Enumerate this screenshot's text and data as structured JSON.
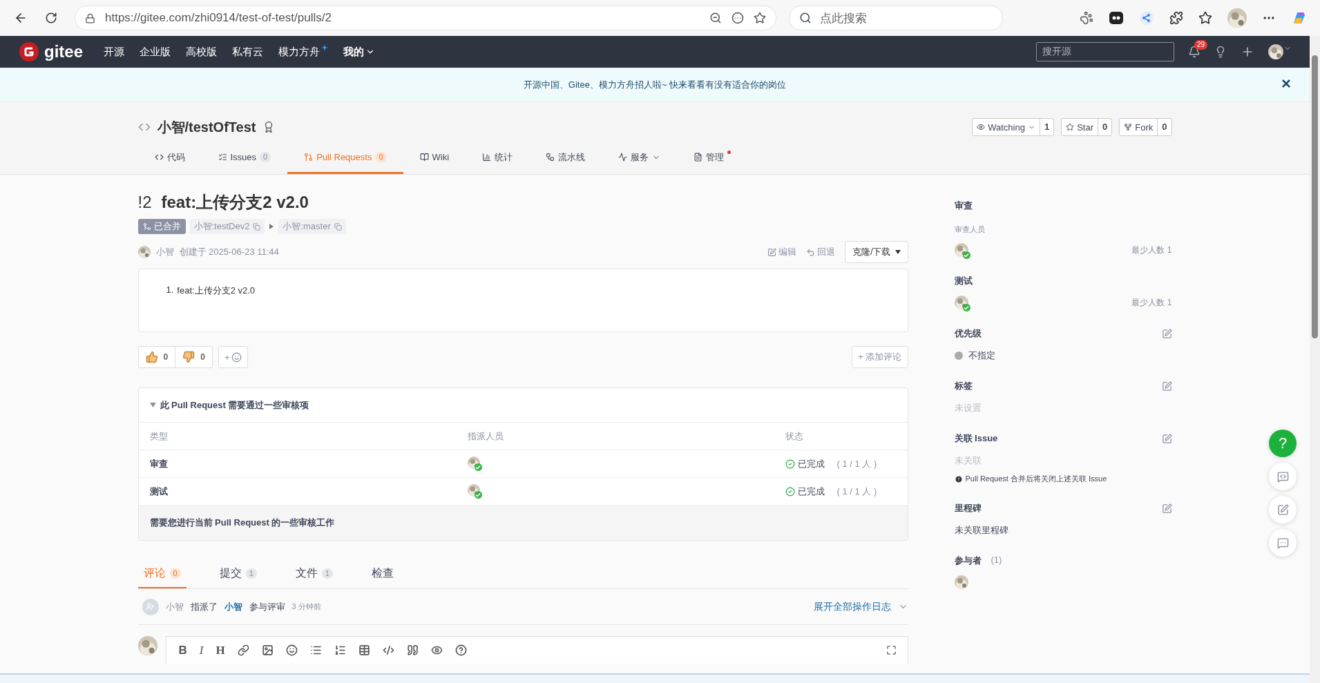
{
  "browser": {
    "url": "https://gitee.com/zhi0914/test-of-test/pulls/2",
    "search_placeholder": "点此搜索"
  },
  "nav": {
    "logo_text": "gitee",
    "items": [
      {
        "label": "开源",
        "kind": "link"
      },
      {
        "label": "企业版",
        "kind": "link"
      },
      {
        "label": "高校版",
        "kind": "link"
      },
      {
        "label": "私有云",
        "kind": "link"
      },
      {
        "label": "模力方舟",
        "kind": "sparkle"
      },
      {
        "label": "我的",
        "kind": "menu"
      }
    ],
    "search_placeholder": "搜开源",
    "notification_count": "29"
  },
  "banner": {
    "text": "开源中国、Gitee、模力方舟招人啦~ 快来看看有没有适合你的岗位"
  },
  "repo": {
    "name": "小智/testOfTest",
    "actions": [
      {
        "label": "Watching",
        "count": "1",
        "kind": "watch"
      },
      {
        "label": "Star",
        "count": "0",
        "kind": "star"
      },
      {
        "label": "Fork",
        "count": "0",
        "kind": "fork"
      }
    ],
    "tabs": [
      {
        "label": "代码",
        "kind": "code",
        "selected": false,
        "dropdown": false,
        "dot": false
      },
      {
        "label": "Issues",
        "count": "0",
        "kind": "issues",
        "selected": false,
        "dropdown": false,
        "dot": false
      },
      {
        "label": "Pull Requests",
        "count": "0",
        "kind": "pulls",
        "selected": true,
        "dropdown": false,
        "dot": false
      },
      {
        "label": "Wiki",
        "kind": "wiki",
        "selected": false,
        "dropdown": false,
        "dot": false
      },
      {
        "label": "统计",
        "kind": "stats",
        "selected": false,
        "dropdown": false,
        "dot": false
      },
      {
        "label": "流水线",
        "kind": "pipeline",
        "selected": false,
        "dropdown": false,
        "dot": false
      },
      {
        "label": "服务",
        "kind": "services",
        "selected": false,
        "dropdown": true,
        "dot": false
      },
      {
        "label": "管理",
        "kind": "manage",
        "selected": false,
        "dropdown": false,
        "dot": true
      }
    ]
  },
  "pr": {
    "number": "!2",
    "title": "feat:上传分支2 v2.0",
    "status": "已合并",
    "source_branch": "小智:testDev2",
    "target_branch": "小智:master",
    "author": "小智",
    "created": "创建于 2025-06-23 11:44",
    "actions": [
      {
        "label": "编辑",
        "kind": "edit"
      },
      {
        "label": "回退",
        "kind": "revert"
      }
    ],
    "clone_button": "克隆/下载",
    "description": [
      {
        "number": "1.",
        "text": "feat:上传分支2 v2.0"
      }
    ],
    "reactions": [
      {
        "kind": "up",
        "count": "0"
      },
      {
        "kind": "down",
        "count": "0"
      }
    ],
    "add_reaction": "+",
    "add_comment": "+ 添加评论"
  },
  "review": {
    "title": "此 Pull Request 需要通过一些审核项",
    "expanded": true,
    "columns": [
      "类型",
      "指派人员",
      "状态"
    ],
    "rows": [
      {
        "type": "审查",
        "status": "已完成",
        "progress": "( 1 / 1 人 )"
      },
      {
        "type": "测试",
        "status": "已完成",
        "progress": "( 1 / 1 人 )"
      }
    ],
    "footer": "需要您进行当前 Pull Request 的一些审核工作"
  },
  "tabs": [
    {
      "label": "评论",
      "count": "0",
      "selected": true
    },
    {
      "label": "提交",
      "count": "1",
      "selected": false
    },
    {
      "label": "文件",
      "count": "1",
      "selected": false
    },
    {
      "label": "检查",
      "selected": false
    }
  ],
  "activity": {
    "actor": "小智",
    "action": "指派了",
    "target": "小智",
    "suffix": "参与评审",
    "time": "3 分钟前",
    "expand_link": "展开全部操作日志"
  },
  "editor": {
    "tools": [
      {
        "kind": "bold",
        "label": "B"
      },
      {
        "kind": "italic",
        "label": "I"
      },
      {
        "kind": "heading",
        "label": "H"
      },
      {
        "kind": "link"
      },
      {
        "kind": "image"
      },
      {
        "kind": "emoji"
      },
      {
        "kind": "bullets"
      },
      {
        "kind": "numbers"
      },
      {
        "kind": "table"
      },
      {
        "kind": "code"
      },
      {
        "kind": "quote"
      },
      {
        "kind": "preview"
      },
      {
        "kind": "help"
      }
    ]
  },
  "sidebar": {
    "review": {
      "title": "审查",
      "subtitle": "审查人员",
      "minimum": "最少人数 1"
    },
    "test": {
      "title": "测试",
      "minimum": "最少人数 1"
    },
    "priority": {
      "title": "优先级",
      "value": "不指定"
    },
    "labels": {
      "title": "标签",
      "value": "未设置"
    },
    "issue": {
      "title": "关联 Issue",
      "value": "未关联",
      "note": "Pull Request 合并后将关闭上述关联 Issue"
    },
    "milestone": {
      "title": "里程碑",
      "value": "未关联里程碑"
    },
    "participants": {
      "title": "参与者",
      "count": "(1)"
    }
  },
  "float": {
    "help": "?"
  }
}
